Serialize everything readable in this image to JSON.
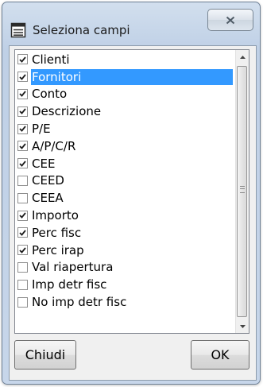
{
  "window": {
    "title": "Seleziona campi"
  },
  "list": {
    "items": [
      {
        "label": "Clienti",
        "checked": true,
        "selected": false
      },
      {
        "label": "Fornitori",
        "checked": true,
        "selected": true
      },
      {
        "label": "Conto",
        "checked": true,
        "selected": false
      },
      {
        "label": "Descrizione",
        "checked": true,
        "selected": false
      },
      {
        "label": "P/E",
        "checked": true,
        "selected": false
      },
      {
        "label": "A/P/C/R",
        "checked": true,
        "selected": false
      },
      {
        "label": "CEE",
        "checked": true,
        "selected": false
      },
      {
        "label": "CEED",
        "checked": false,
        "selected": false
      },
      {
        "label": "CEEA",
        "checked": false,
        "selected": false
      },
      {
        "label": "Importo",
        "checked": true,
        "selected": false
      },
      {
        "label": "Perc fisc",
        "checked": true,
        "selected": false
      },
      {
        "label": "Perc irap",
        "checked": true,
        "selected": false
      },
      {
        "label": "Val riapertura",
        "checked": false,
        "selected": false
      },
      {
        "label": "Imp detr fisc",
        "checked": false,
        "selected": false
      },
      {
        "label": "No imp detr fisc",
        "checked": false,
        "selected": false
      }
    ]
  },
  "buttons": {
    "close_label": "Chiudi",
    "ok_label": "OK"
  },
  "icons": {
    "title": "list-window-icon",
    "close": "close-x-icon",
    "check": "check-icon",
    "scroll_up": "scroll-up-arrow-icon",
    "scroll_down": "scroll-down-arrow-icon"
  },
  "colors": {
    "selection": "#3399ff",
    "frame": "#bfd0e6"
  }
}
